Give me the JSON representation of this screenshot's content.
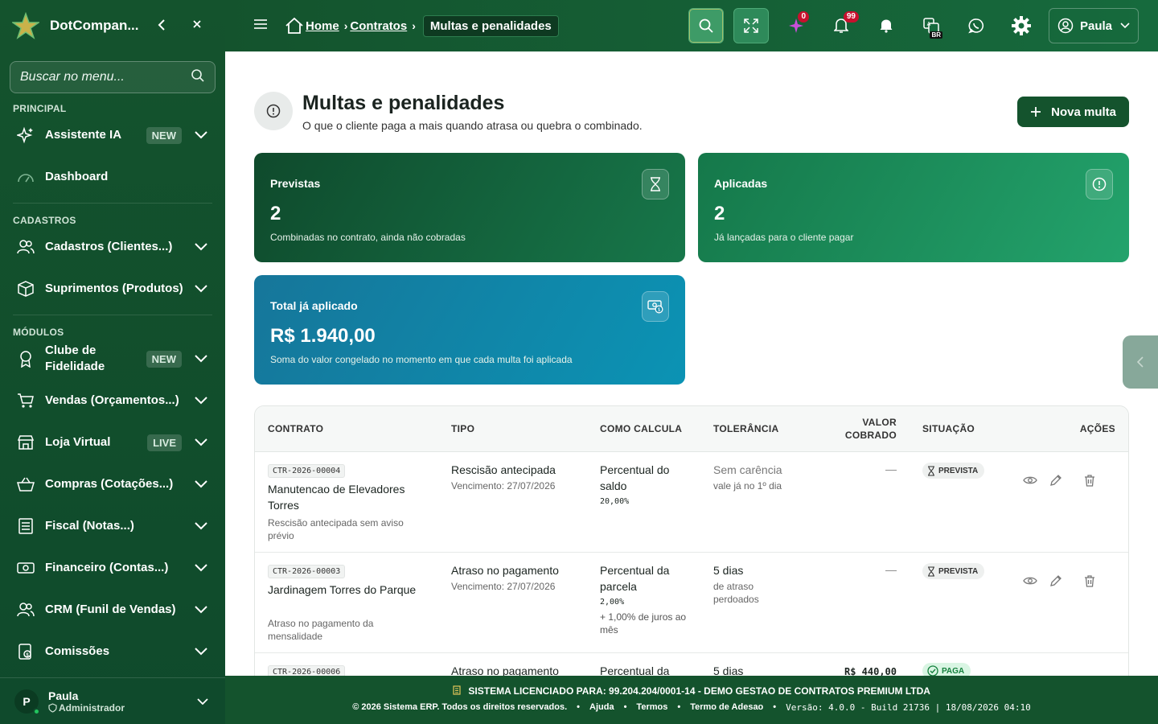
{
  "sidebar": {
    "brand": "DotCompan...",
    "search_placeholder": "Buscar no menu...",
    "sections": {
      "principal": "PRINCIPAL",
      "cadastros": "CADASTROS",
      "modulos": "MÓDULOS"
    },
    "items": [
      {
        "label": "Assistente IA",
        "badge": "NEW"
      },
      {
        "label": "Dashboard"
      },
      {
        "label": "Cadastros (Clientes...)"
      },
      {
        "label": "Suprimentos (Produtos)"
      },
      {
        "label": "Clube de Fidelidade",
        "badge": "NEW"
      },
      {
        "label": "Vendas (Orçamentos...)"
      },
      {
        "label": "Loja Virtual",
        "badge": "LIVE"
      },
      {
        "label": "Compras (Cotações...)"
      },
      {
        "label": "Fiscal (Notas...)"
      },
      {
        "label": "Financeiro (Contas...)"
      },
      {
        "label": "CRM (Funil de Vendas)"
      },
      {
        "label": "Comissões"
      }
    ],
    "user": {
      "initial": "P",
      "name": "Paula",
      "role": "Administrador"
    }
  },
  "topbar": {
    "breadcrumb": {
      "home": "Home",
      "contratos": "Contratos",
      "current": "Multas e penalidades"
    },
    "sparkle_count": "0",
    "notif_count": "99",
    "lang_tag": "BR",
    "user_name": "Paula"
  },
  "page": {
    "title": "Multas e penalidades",
    "subtitle": "O que o cliente paga a mais quando atrasa ou quebra o combinado.",
    "new_button": "Nova multa"
  },
  "cards": [
    {
      "label": "Previstas",
      "value": "2",
      "desc": "Combinadas no contrato, ainda não cobradas",
      "icon": "hourglass-icon"
    },
    {
      "label": "Aplicadas",
      "value": "2",
      "desc": "Já lançadas para o cliente pagar",
      "icon": "alert-circle-icon"
    },
    {
      "label": "Total já aplicado",
      "value": "R$ 1.940,00",
      "desc": "Soma do valor congelado no momento em que cada multa foi aplicada",
      "icon": "money-icon"
    }
  ],
  "table": {
    "headers": {
      "contrato": "CONTRATO",
      "tipo": "TIPO",
      "como_calcula": "COMO CALCULA",
      "tolerancia": "TOLERÂNCIA",
      "valor_1": "VALOR",
      "valor_2": "COBRADO",
      "situacao": "SITUAÇÃO",
      "acoes": "AÇÕES"
    },
    "rows": [
      {
        "code": "CTR-2026-00004",
        "name": "Manutencao de Elevadores Torres",
        "desc": "Rescisão antecipada sem aviso prévio",
        "tipo": "Rescisão antecipada",
        "venc": "Vencimento: 27/07/2026",
        "calc": "Percentual do saldo",
        "calc_value": "20,00%",
        "calc_extra": "",
        "tol": "Sem carência",
        "tol_sub": "vale já no 1º dia",
        "valor": "—",
        "status": "PREVISTA"
      },
      {
        "code": "CTR-2026-00003",
        "name": "Jardinagem Torres do Parque",
        "desc": "Atraso no pagamento da mensalidade",
        "tipo": "Atraso no pagamento",
        "venc": "Vencimento: 27/07/2026",
        "calc": "Percentual da parcela",
        "calc_value": "2,00%",
        "calc_extra": "+ 1,00% de juros ao mês",
        "tol": "5 dias",
        "tol_sub": "de atraso perdoados",
        "valor": "—",
        "status": "PREVISTA"
      },
      {
        "code": "CTR-2026-00006",
        "name": "",
        "desc": "",
        "tipo": "Atraso no pagamento",
        "venc": "",
        "calc": "Percentual da",
        "calc_value": "",
        "calc_extra": "",
        "tol": "5 dias",
        "tol_sub": "",
        "valor": "R$ 440,00",
        "status": "PAGA"
      }
    ]
  },
  "footer": {
    "license": "SISTEMA LICENCIADO PARA: 99.204.204/0001-14 - DEMO GESTAO DE CONTRATOS PREMIUM LTDA",
    "copyright": "© 2026 Sistema ERP. Todos os direitos reservados.",
    "links": [
      "Ajuda",
      "Termos",
      "Termo de Adesao"
    ],
    "version": "Versão: 4.0.0 - Build 21736 | 18/08/2026 04:10"
  },
  "colors": {
    "primary": "#14532d",
    "accent": "#22c55e",
    "teal": "#0b93b4"
  }
}
